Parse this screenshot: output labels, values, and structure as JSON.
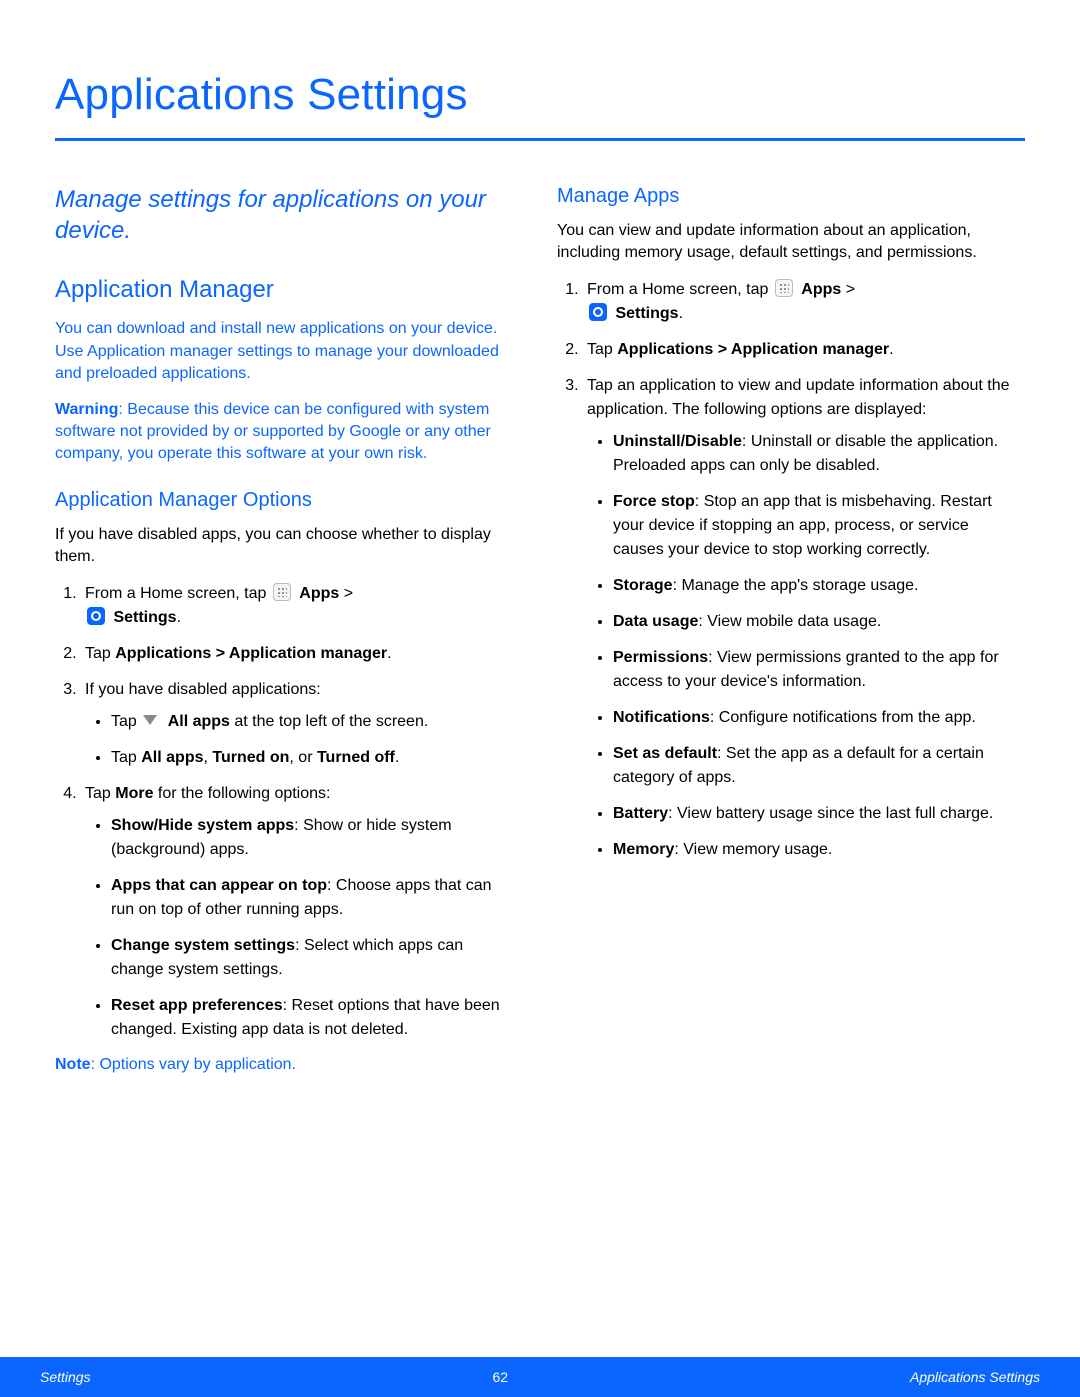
{
  "page_title": "Applications Settings",
  "intro": "Manage settings for applications on your device.",
  "left": {
    "h2": "Application Manager",
    "p1": "You can download and install new applications on your device. Use Application manager settings to manage your downloaded and preloaded applications.",
    "warning_label": "Warning",
    "warning_text": ": Because this device can be configured with system software not provided by or supported by Google or any other company, you operate this software at your own risk.",
    "h3": "Application Manager Options",
    "p2": "If you have disabled apps, you can choose whether to display them.",
    "step1_a": "From a Home screen, tap ",
    "apps_label": "Apps",
    "gt": " > ",
    "settings_label": "Settings",
    "period": ".",
    "step2_a": "Tap ",
    "step2_b": "Applications > Application manager",
    "step3": "If you have disabled applications:",
    "b1_a": "Tap ",
    "b1_b": "All apps",
    "b1_c": " at the top left of the screen.",
    "b2_a": "Tap ",
    "b2_b": "All apps",
    "b2_c": ", ",
    "b2_d": "Turned on",
    "b2_e": ", or ",
    "b2_f": "Turned off",
    "step4_a": "Tap ",
    "step4_b": "More",
    "step4_c": " for the following options:",
    "m1_a": "Show/Hide system apps",
    "m1_b": ": Show or hide system (background) apps.",
    "m2_a": "Apps that can appear on top",
    "m2_b": ": Choose apps that can run on top of other running apps.",
    "m3_a": "Change system settings",
    "m3_b": ": Select which apps can change system settings.",
    "m4_a": "Reset app preferences",
    "m4_b": ": Reset options that have been changed. Existing app data is not deleted.",
    "note_label": "Note",
    "note_text": ": Options vary by application."
  },
  "right": {
    "h3": "Manage Apps",
    "p1": "You can view and update information about an application, including memory usage, default settings, and permissions.",
    "step3": "Tap an application to view and update information about the application. The following options are displayed:",
    "o1_a": "Uninstall/Disable",
    "o1_b": ": Uninstall or disable the application. Preloaded apps can only be disabled.",
    "o2_a": "Force stop",
    "o2_b": ": Stop an app that is misbehaving. Restart your device if stopping an app, process, or service causes your device to stop working correctly.",
    "o3_a": "Storage",
    "o3_b": ": Manage the app's storage usage.",
    "o4_a": "Data usage",
    "o4_b": ": View mobile data usage.",
    "o5_a": "Permissions",
    "o5_b": ": View permissions granted to the app for access to your device's information.",
    "o6_a": "Notifications",
    "o6_b": ": Configure notifications from the app.",
    "o7_a": "Set as default",
    "o7_b": ": Set the app as a default for a certain category of apps.",
    "o8_a": "Battery",
    "o8_b": ": View battery usage since the last full charge.",
    "o9_a": "Memory",
    "o9_b": ": View memory usage."
  },
  "footer": {
    "left": "Settings",
    "center": "62",
    "right": "Applications Settings"
  }
}
